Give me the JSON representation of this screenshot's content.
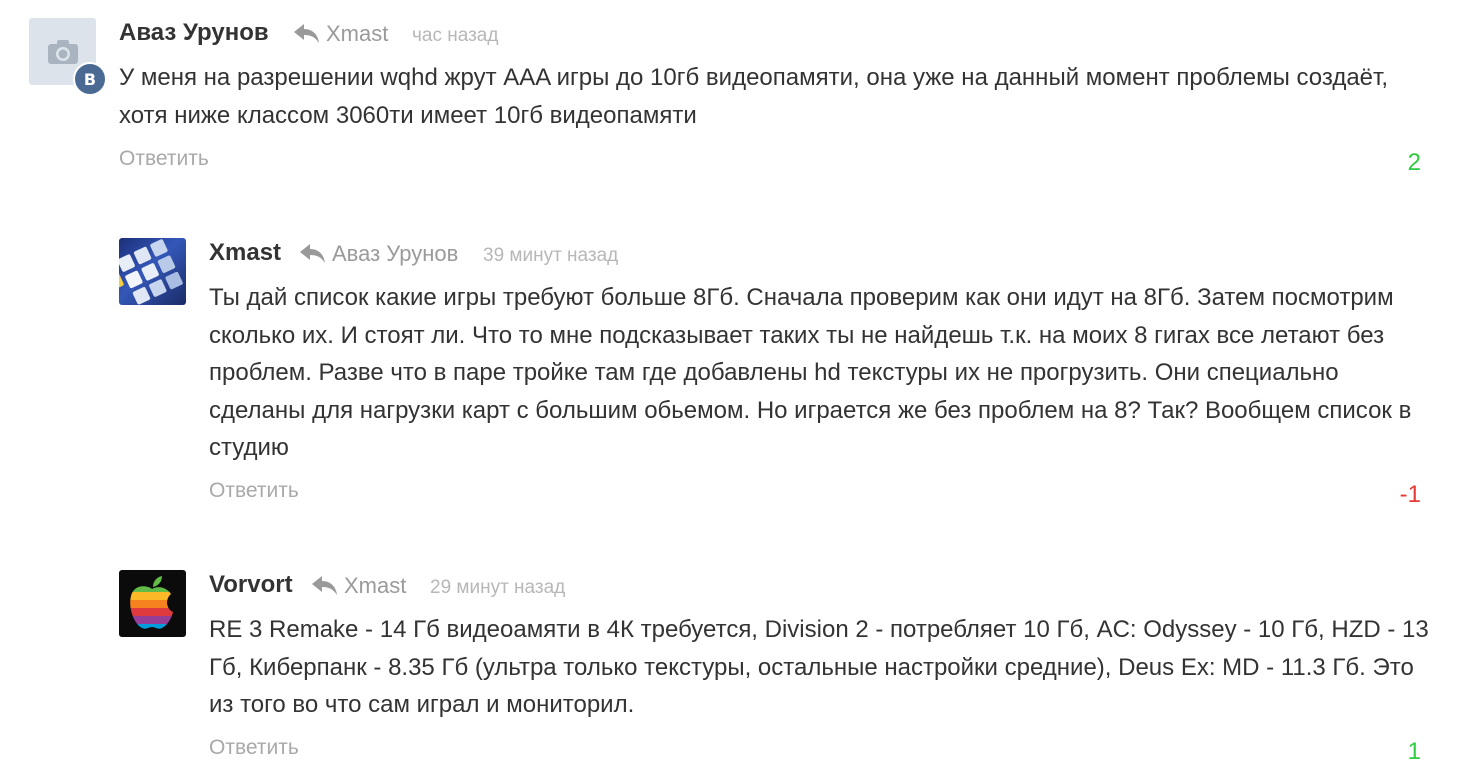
{
  "comments": [
    {
      "author": "Аваз Урунов",
      "reply_to": "Xmast",
      "time": "час назад",
      "text": "У меня на разрешении wqhd жрут AAA игры до 10гб видеопамяти, она уже на данный момент проблемы создаёт, хотя ниже классом 3060ти имеет 10гб видеопамяти",
      "reply_label": "Ответить",
      "score": "2",
      "avatar": "camera-placeholder-icon",
      "badge": "В"
    },
    {
      "author": "Xmast",
      "reply_to": "Аваз Урунов",
      "time": "39 минут назад",
      "text": "Ты дай список какие игры требуют больше 8Гб. Сначала проверим как они идут на 8Гб. Затем посмотрим сколько их. И стоят ли. Что то мне подсказывает таких ты не найдешь т.к. на моих 8 гигах все летают без проблем. Разве что в паре тройке там где добавлены hd текстуры их не прогрузить. Они специально сделаны для нагрузки карт с большим обьемом. Но играется же без проблем на 8? Так? Вообщем список в студию",
      "reply_label": "Ответить",
      "score": "-1",
      "avatar": "keyboard-keys-avatar"
    },
    {
      "author": "Vorvort",
      "reply_to": "Xmast",
      "time": "29 минут назад",
      "text": "RE 3 Remake - 14 Гб видеоамяти в 4К требуется, Division 2 - потребляет 10 Гб, AC: Odyssey - 10 Гб, HZD - 13 Гб, Киберпанк - 8.35 Гб (ультра только текстуры, остальные настройки средние), Deus Ex: MD - 11.3 Гб. Это из того во что сам играл и мониторил.",
      "reply_label": "Ответить",
      "score": "1",
      "avatar": "rainbow-apple-avatar"
    }
  ],
  "colors": {
    "positive": "#2ecc40",
    "negative": "#e53935",
    "muted": "#9a9a9a",
    "text": "#333333"
  }
}
